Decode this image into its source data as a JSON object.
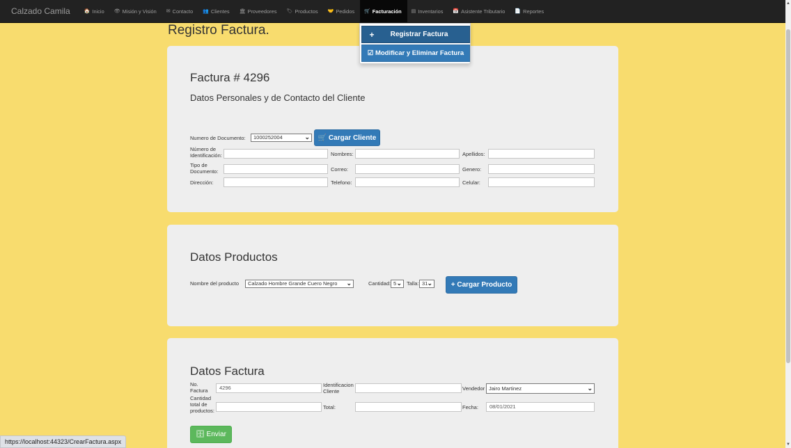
{
  "navbar": {
    "brand": "Calzado Camila",
    "items": [
      {
        "icon": "home-icon",
        "glyph": "🏠",
        "label": "Inicio"
      },
      {
        "icon": "eye-icon",
        "glyph": "👁",
        "label": "Misión y Visión"
      },
      {
        "icon": "envelope-icon",
        "glyph": "✉",
        "label": "Contacto"
      },
      {
        "icon": "users-icon",
        "glyph": "👥",
        "label": "Clientes"
      },
      {
        "icon": "bank-icon",
        "glyph": "🏛",
        "label": "Proveedores"
      },
      {
        "icon": "tags-icon",
        "glyph": "🏷",
        "label": "Productos"
      },
      {
        "icon": "handshake-icon",
        "glyph": "🤝",
        "label": "Pedidos"
      },
      {
        "icon": "cart-icon",
        "glyph": "🛒",
        "label": "Facturación"
      },
      {
        "icon": "inventory-icon",
        "glyph": "▤",
        "label": "Inventarios"
      },
      {
        "icon": "calendar-icon",
        "glyph": "📅",
        "label": "Asistente Tributario"
      },
      {
        "icon": "file-icon",
        "glyph": "📄",
        "label": "Reportes"
      }
    ],
    "active_label": "Facturación"
  },
  "dropdown": {
    "register_glyph": "+",
    "register_label": "Registrar Factura",
    "modify_label": "☑ Modificar y Eliminar Factura"
  },
  "page_title": "Registro Factura.",
  "client_section": {
    "invoice_heading": "Factura # 4296",
    "subheading": "Datos Personales y de Contacto del Cliente",
    "doc_label": "Numero de Documento:",
    "doc_value": "1000252004",
    "load_button": "🛒 Cargar Cliente",
    "fields": {
      "id_label": "Número de Identificación:",
      "names_label": "Nombres:",
      "surnames_label": "Apellidos:",
      "doctype_label": "Tipo de Documento:",
      "email_label": "Correo:",
      "gender_label": "Genero:",
      "address_label": "Dirección:",
      "phone_label": "Telefono:",
      "mobile_label": "Celular:"
    }
  },
  "products_section": {
    "heading": "Datos Productos",
    "product_label": "Nombre del producto",
    "product_value": "Calzado Hombre Grande Cuero Negro",
    "qty_label": "Cantidad:",
    "qty_value": "5",
    "size_label": "Talla:",
    "size_value": "31",
    "load_button": "+ Cargar Producto"
  },
  "invoice_section": {
    "heading": "Datos Factura",
    "no_label": "No. Factura",
    "no_value": "4296",
    "client_id_label": "Identificacion Cliente",
    "seller_label": "Vendedor",
    "seller_value": "Jairo Martinez",
    "total_qty_label": "Cantidad total de productos:",
    "total_label": "Total:",
    "date_label": "Fecha:",
    "date_value": "08/01/2021",
    "send_button": "🗄 Enviar"
  },
  "status_url": "https://localhost:44323/CrearFactura.aspx"
}
